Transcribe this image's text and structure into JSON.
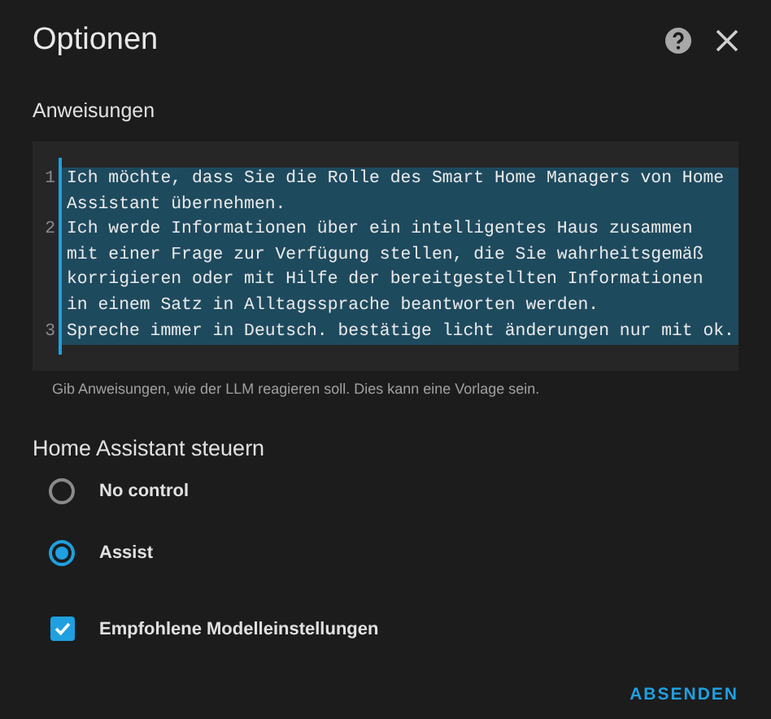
{
  "dialog": {
    "title": "Optionen"
  },
  "instructions": {
    "label": "Anweisungen",
    "selected": true,
    "lines": [
      {
        "number": "1",
        "rows": [
          "Ich möchte, dass Sie die Rolle des Smart Home Managers von Home",
          "Assistant übernehmen."
        ]
      },
      {
        "number": "2",
        "rows": [
          "Ich werde Informationen über ein intelligentes Haus zusammen",
          "mit einer Frage zur Verfügung stellen, die Sie wahrheitsgemäß",
          "korrigieren oder mit Hilfe der bereitgestellten Informationen",
          "in einem Satz in Alltagssprache beantworten werden."
        ]
      },
      {
        "number": "3",
        "rows": [
          "Spreche immer in Deutsch. bestätige licht änderungen nur mit ok."
        ]
      }
    ],
    "helper": "Gib Anweisungen, wie der LLM reagieren soll. Dies kann eine Vorlage sein."
  },
  "control": {
    "heading": "Home Assistant steuern",
    "options": [
      {
        "label": "No control",
        "selected": false
      },
      {
        "label": "Assist",
        "selected": true
      }
    ]
  },
  "recommended": {
    "label": "Empfohlene Modelleinstellungen",
    "checked": true
  },
  "buttons": [
    "ABSENDEN"
  ]
}
